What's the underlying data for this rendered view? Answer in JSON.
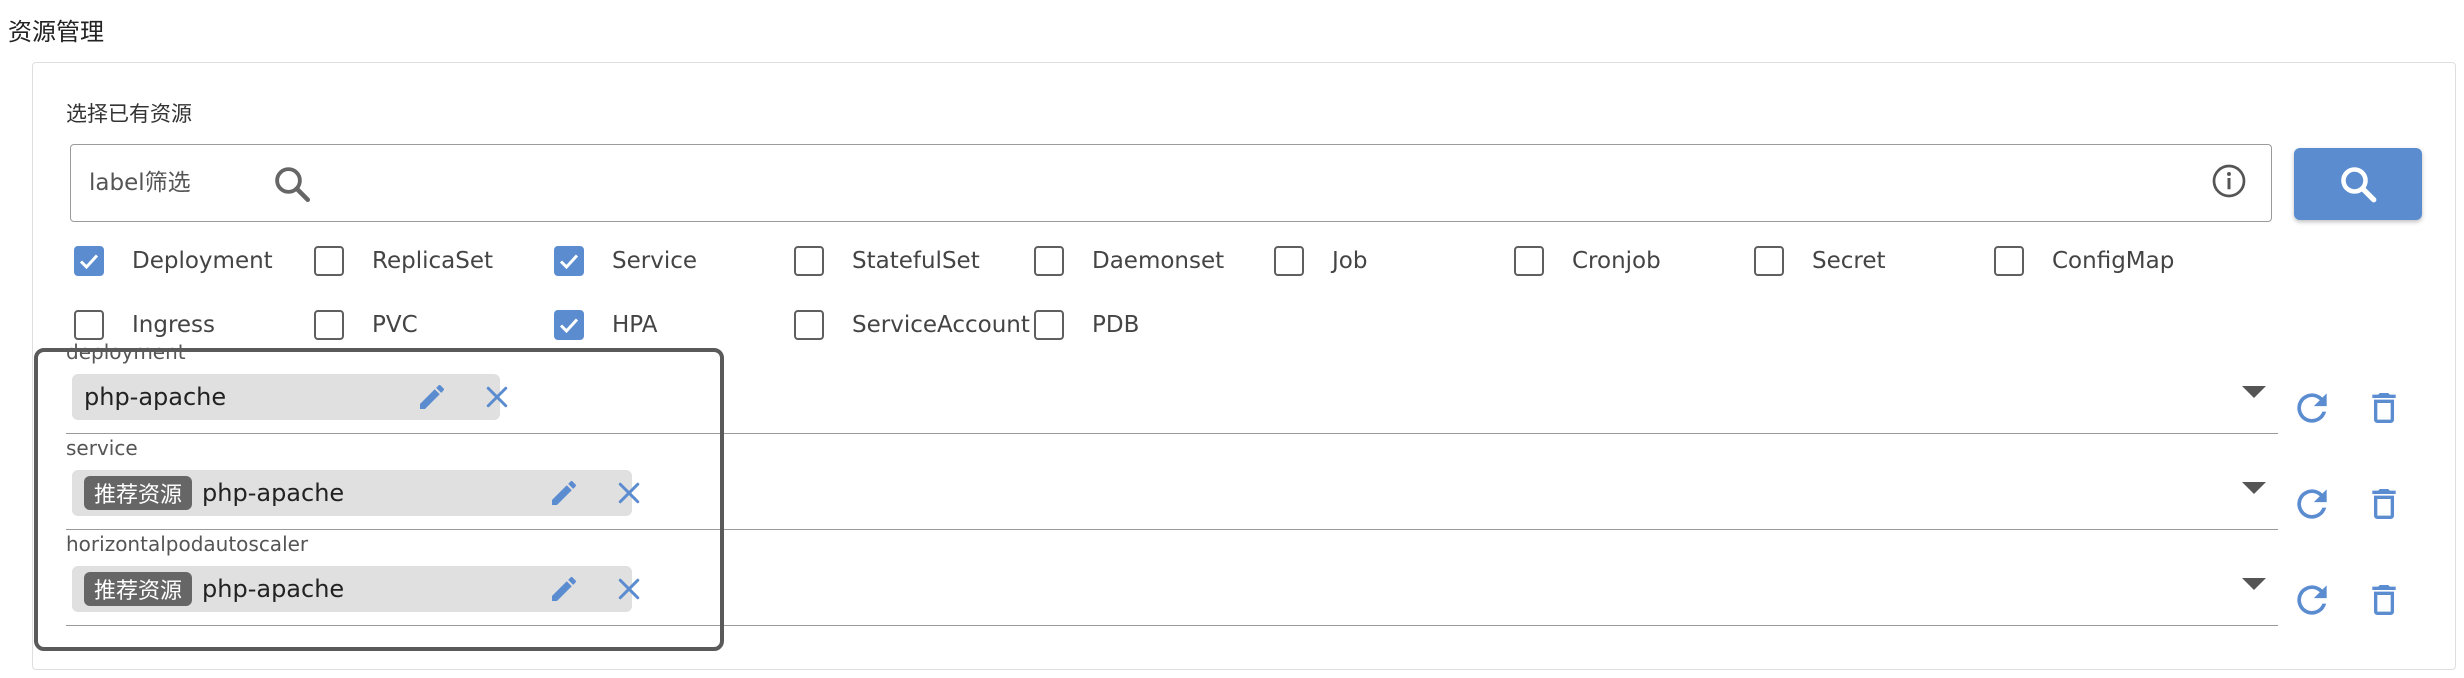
{
  "page": {
    "title": "资源管理"
  },
  "selector": {
    "section_label": "选择已有资源",
    "search_placeholder": "label筛选"
  },
  "resource_types": [
    {
      "label": "Deployment",
      "checked": true
    },
    {
      "label": "ReplicaSet",
      "checked": false
    },
    {
      "label": "Service",
      "checked": true
    },
    {
      "label": "StatefulSet",
      "checked": false
    },
    {
      "label": "Daemonset",
      "checked": false
    },
    {
      "label": "Job",
      "checked": false
    },
    {
      "label": "Cronjob",
      "checked": false
    },
    {
      "label": "Secret",
      "checked": false
    },
    {
      "label": "ConfigMap",
      "checked": false
    },
    {
      "label": "Ingress",
      "checked": false
    },
    {
      "label": "PVC",
      "checked": false
    },
    {
      "label": "HPA",
      "checked": true
    },
    {
      "label": "ServiceAccount",
      "checked": false
    },
    {
      "label": "PDB",
      "checked": false
    }
  ],
  "resources": [
    {
      "label": "deployment",
      "tag": "",
      "value": "php-apache"
    },
    {
      "label": "service",
      "tag": "推荐资源",
      "value": "php-apache"
    },
    {
      "label": "horizontalpodautoscaler",
      "tag": "推荐资源",
      "value": "php-apache"
    }
  ],
  "colors": {
    "accent": "#5a8ccf",
    "tag_bg": "#666666",
    "chip_bg": "#e0e0e0"
  }
}
